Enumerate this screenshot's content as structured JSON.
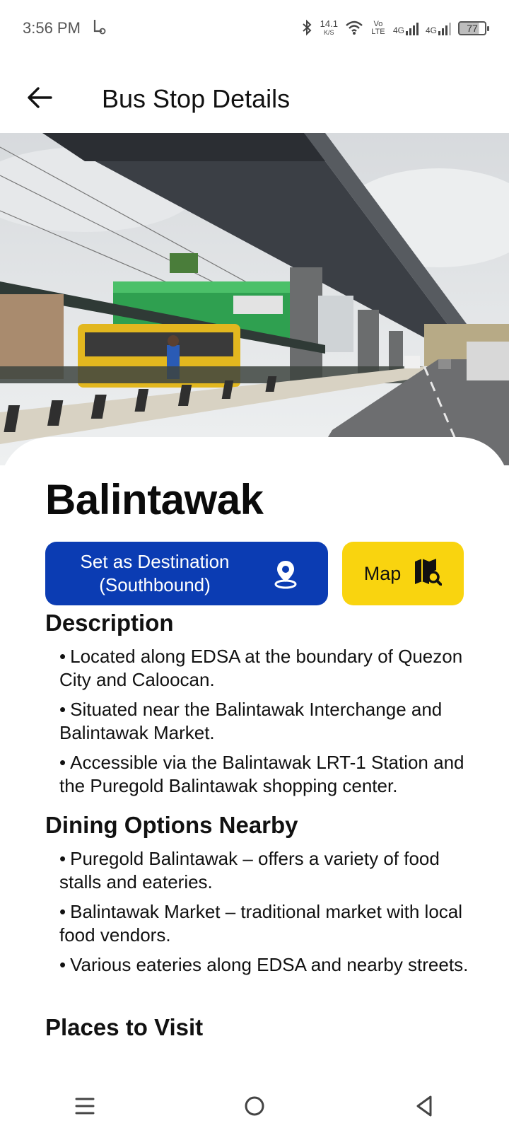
{
  "status_bar": {
    "time": "3:56 PM",
    "net_speed": "14.1",
    "net_unit": "K/S",
    "volte": "Vo LTE",
    "network_1": "4G",
    "network_2": "4G",
    "battery": "77"
  },
  "app_bar": {
    "title": "Bus Stop Details"
  },
  "stop": {
    "name": "Balintawak"
  },
  "actions": {
    "destination_label_line1": "Set as Destination",
    "destination_label_line2": "(Southbound)",
    "map_label": "Map"
  },
  "description": {
    "title": "Description",
    "items": [
      "Located along EDSA at the boundary of Quezon City and Caloocan.",
      "Situated near the Balintawak Interchange and Balintawak Market.",
      "Accessible via the Balintawak LRT-1 Station and the Puregold Balintawak shopping center."
    ]
  },
  "dining": {
    "title": "Dining Options Nearby",
    "items": [
      "Puregold Balintawak – offers a variety of food stalls and eateries.",
      "Balintawak Market – traditional market with local food vendors.",
      "Various eateries along EDSA and nearby streets."
    ]
  },
  "places": {
    "title": "Places to Visit"
  },
  "colors": {
    "primary_blue": "#0b3cb3",
    "map_yellow": "#f9d40f"
  },
  "icons": {
    "back": "arrow-left-icon",
    "location": "location-pin-icon",
    "map": "map-search-icon",
    "nav_menu": "menu-icon",
    "nav_home": "home-circle-icon",
    "nav_back": "back-triangle-icon"
  }
}
